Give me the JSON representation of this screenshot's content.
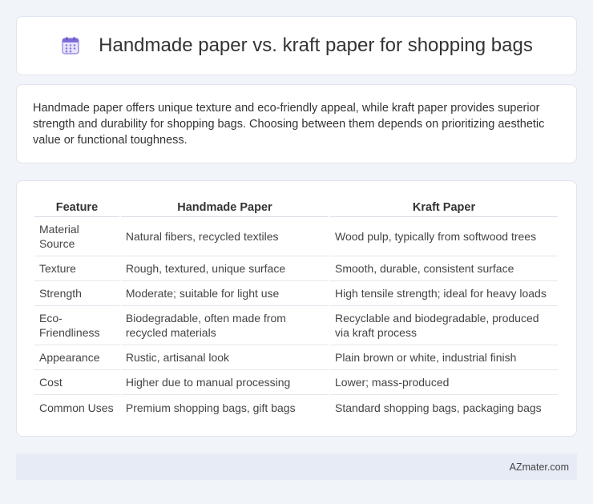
{
  "header": {
    "title": "Handmade paper vs. kraft paper for shopping bags",
    "icon": "calendar-icon",
    "icon_color": "#7b6cd9"
  },
  "description": "Handmade paper offers unique texture and eco-friendly appeal, while kraft paper provides superior strength and durability for shopping bags. Choosing between them depends on prioritizing aesthetic value or functional toughness.",
  "table": {
    "headers": [
      "Feature",
      "Handmade Paper",
      "Kraft Paper"
    ],
    "rows": [
      [
        "Material Source",
        "Natural fibers, recycled textiles",
        "Wood pulp, typically from softwood trees"
      ],
      [
        "Texture",
        "Rough, textured, unique surface",
        "Smooth, durable, consistent surface"
      ],
      [
        "Strength",
        "Moderate; suitable for light use",
        "High tensile strength; ideal for heavy loads"
      ],
      [
        "Eco-Friendliness",
        "Biodegradable, often made from recycled materials",
        "Recyclable and biodegradable, produced via kraft process"
      ],
      [
        "Appearance",
        "Rustic, artisanal look",
        "Plain brown or white, industrial finish"
      ],
      [
        "Cost",
        "Higher due to manual processing",
        "Lower; mass-produced"
      ],
      [
        "Common Uses",
        "Premium shopping bags, gift bags",
        "Standard shopping bags, packaging bags"
      ]
    ]
  },
  "footer": {
    "brand": "AZmater.com"
  }
}
